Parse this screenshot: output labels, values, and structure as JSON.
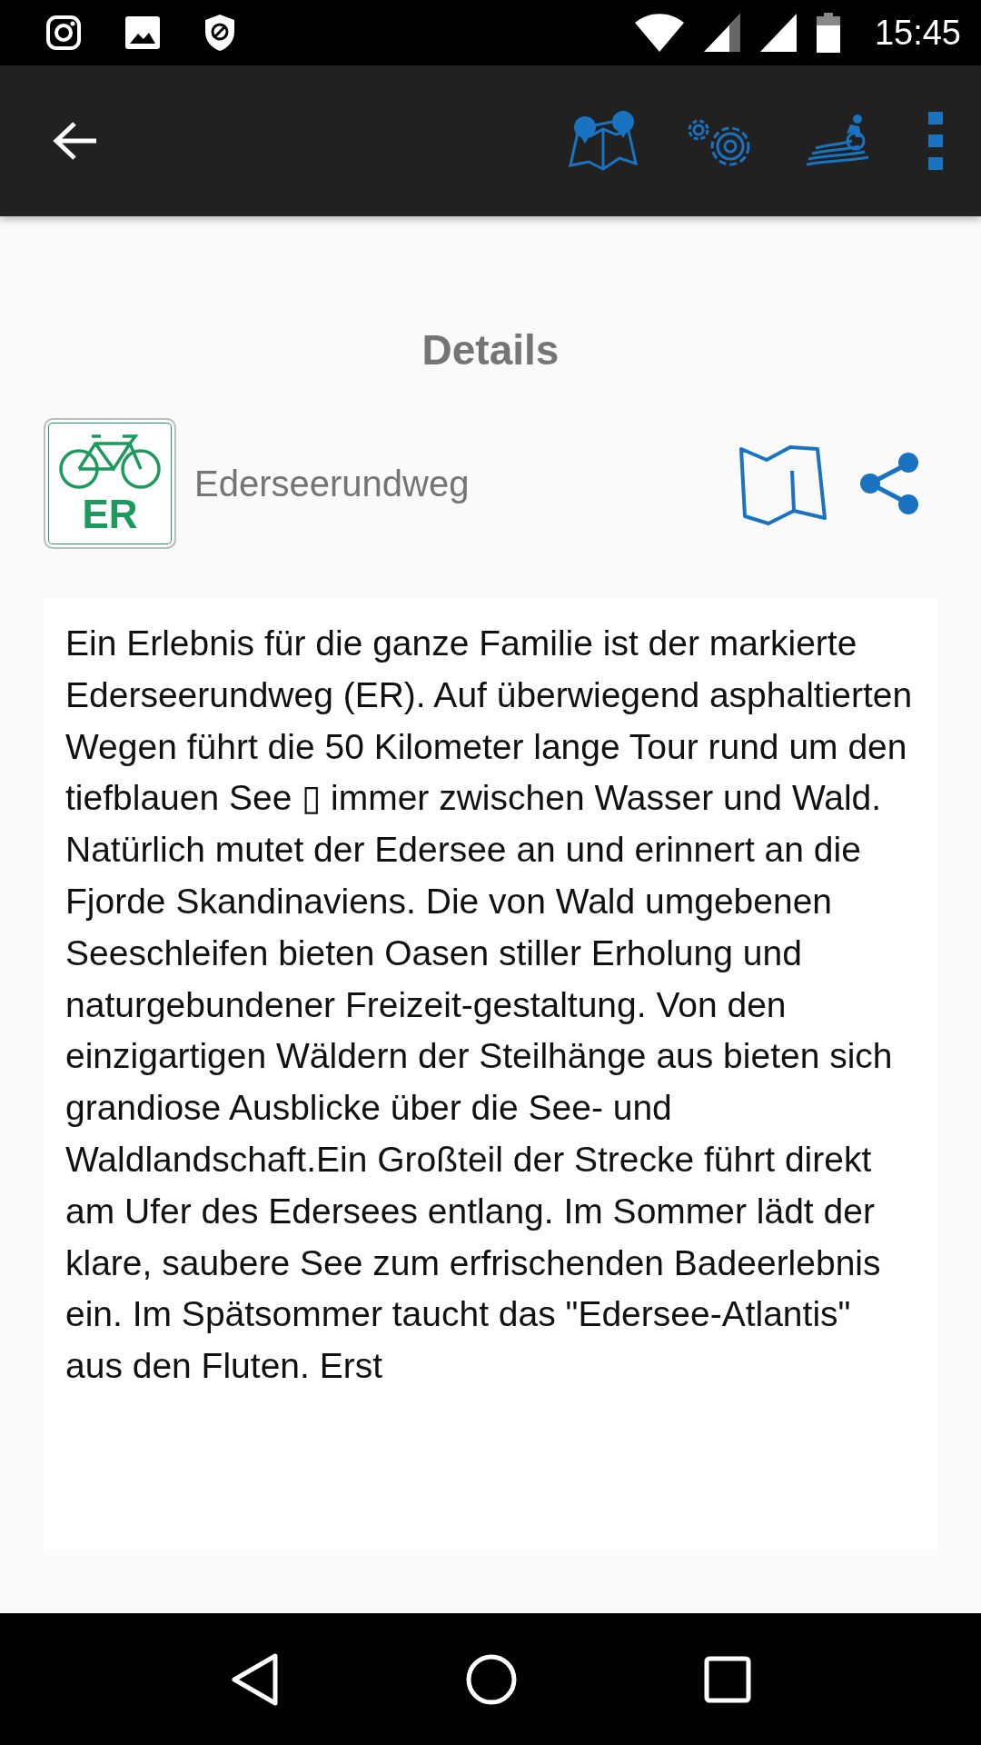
{
  "status_bar": {
    "time": "15:45"
  },
  "toolbar": {
    "back": true
  },
  "heading": "Details",
  "route": {
    "badge": "ER",
    "name": "Ederseerundweg"
  },
  "description": "Ein Erlebnis für die ganze Familie ist der markierte Ederseerundweg (ER). Auf überwiegend asphaltierten Wegen führt die 50 Kilometer lange Tour rund um den tiefblauen See ▯ immer zwischen Wasser und Wald. Natürlich mutet der Edersee an und erinnert an die Fjorde Skandinaviens. Die von Wald umgebenen Seeschleifen bieten Oasen stiller Erholung und naturgebundener Freizeit-gestaltung. Von den einzigartigen Wäldern der Steilhänge aus bieten sich grandiose Ausblicke über die See- und Waldlandschaft.Ein Großteil der Strecke führt direkt am Ufer des Edersees entlang. Im Sommer lädt der klare, saubere See zum erfrischenden Badeerlebnis ein. Im Spätsommer taucht das \"Edersee-Atlantis\" aus den Fluten. Erst"
}
